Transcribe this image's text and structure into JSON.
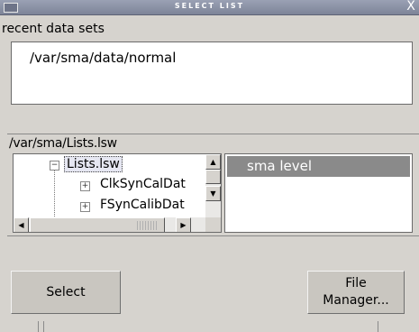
{
  "window": {
    "title": "SELECT LIST",
    "close_glyph": "X"
  },
  "recent": {
    "label": "recent data sets",
    "items": [
      "/var/sma/data/normal"
    ]
  },
  "browser": {
    "path": "/var/sma/Lists.lsw",
    "tree": {
      "root_expander": "−",
      "root_label": "Lists.lsw",
      "children": [
        {
          "expander": "+",
          "label": "ClkSynCalDat"
        },
        {
          "expander": "+",
          "label": "FSynCalibDat"
        }
      ]
    },
    "list": {
      "items": [
        "sma level"
      ],
      "selected_index": 0
    }
  },
  "buttons": {
    "select": "Select",
    "file_manager_line1": "File",
    "file_manager_line2": "Manager..."
  },
  "icons": {
    "scroll_up": "▲",
    "scroll_down": "▼",
    "scroll_left": "◀",
    "scroll_right": "▶"
  }
}
